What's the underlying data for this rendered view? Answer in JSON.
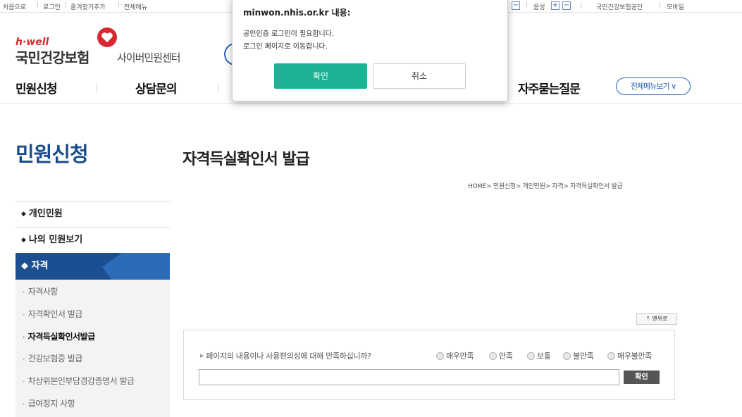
{
  "topbar": {
    "left_links": [
      "처음으로",
      "로그인",
      "즐겨찾기추가",
      "전체메뉴"
    ],
    "zoom_plus": "+",
    "zoom_minus": "−",
    "voice_label": "음성",
    "right_links": [
      "국민건강보험공단",
      "모바일"
    ]
  },
  "logo": {
    "tagline": "h·well",
    "name": "국민건강보험",
    "subtitle": "사이버민원센터",
    "brand_color": "#d7282f"
  },
  "gnb": {
    "items": [
      "민원신청",
      "상담문의",
      "자주묻는질문"
    ],
    "all_menu": "전체메뉴보기"
  },
  "lnb": {
    "title": "민원신청",
    "items": [
      "개인민원",
      "나의 민원보기"
    ],
    "active": "자격",
    "sub_items": [
      "자격사항",
      "자격확인서 발급",
      "자격득실확인서발급",
      "건강보험증 발급",
      "차상위본인부담경감증명서 발급",
      "급여정지 사항"
    ],
    "active_sub_index": 2,
    "accent": "#1c4f91"
  },
  "content": {
    "title": "자격득실확인서 발급",
    "breadcrumb": "HOME> 민원신청> 개인민원> 자격> 자격득실확인서 발급",
    "to_top": "맨위로"
  },
  "survey": {
    "question": "페이지의 내용이나 사용편의성에 대해 만족하십니까?",
    "options": [
      "매우만족",
      "만족",
      "보통",
      "불만족",
      "매우불만족"
    ],
    "submit": "확인"
  },
  "dialog": {
    "origin": "minwon.nhis.or.kr 내용:",
    "message_line1": "공인인증 로그인이 필요합니다.",
    "message_line2": "로그인 페이지로 이동합니다.",
    "ok": "확인",
    "cancel": "취소",
    "ok_color": "#1bb394"
  }
}
